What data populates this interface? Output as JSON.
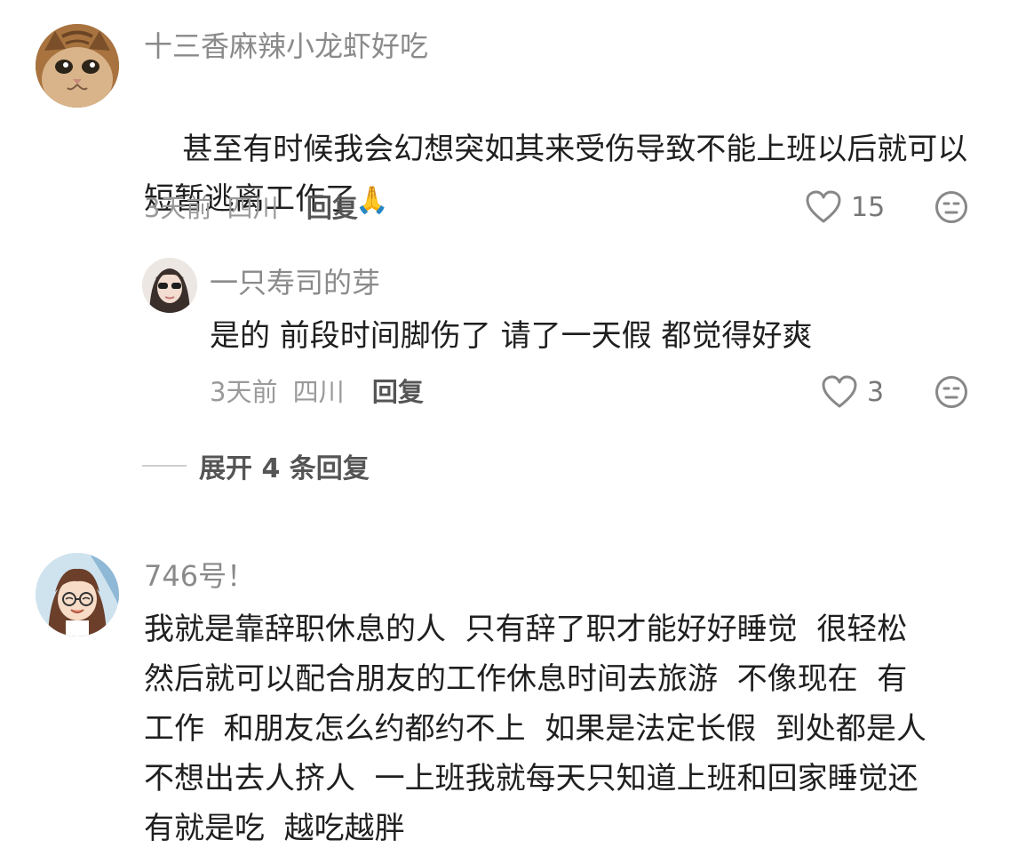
{
  "comments": [
    {
      "username": "十三香麻辣小龙虾好吃",
      "content": "甚至有时候我会幻想突如其来受伤导致不能上班以后就可以\n短暂逃离工作了",
      "emoji": "🙏",
      "time": "3天前",
      "location": "四川",
      "reply_label": "回复",
      "likes": "15",
      "replies": [
        {
          "username": "一只寿司的芽",
          "content": "是的 前段时间脚伤了 请了一天假 都觉得好爽",
          "time": "3天前",
          "location": "四川",
          "reply_label": "回复",
          "likes": "3"
        }
      ],
      "expand_label": "展开 4 条回复"
    },
    {
      "username": "746号！",
      "content": "我就是靠辞职休息的人  只有辞了职才能好好睡觉  很轻松\n然后就可以配合朋友的工作休息时间去旅游  不像现在  有\n工作  和朋友怎么约都约不上  如果是法定长假  到处都是人\n不想出去人挤人  一上班我就每天只知道上班和回家睡觉还\n有就是吃  越吃越胖"
    }
  ],
  "colors": {
    "username": "#8a8a8a",
    "text": "#1f1f1f",
    "meta": "#9a9a9a",
    "reply": "#555555"
  },
  "icons": {
    "like": "heart-outline-icon",
    "dislike": "neutral-face-icon"
  }
}
